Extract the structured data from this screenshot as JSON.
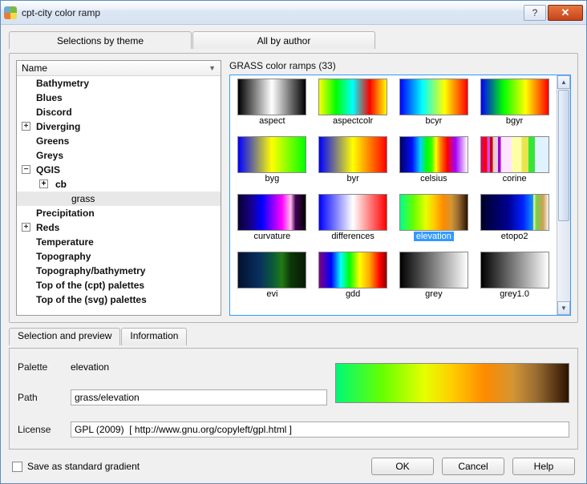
{
  "window": {
    "title": "cpt-city color ramp"
  },
  "tabs": {
    "selections": "Selections by theme",
    "author": "All by author"
  },
  "tree": {
    "header": "Name",
    "items": [
      {
        "label": "Bathymetry"
      },
      {
        "label": "Blues"
      },
      {
        "label": "Discord"
      },
      {
        "label": "Diverging",
        "expandable": true
      },
      {
        "label": "Greens"
      },
      {
        "label": "Greys"
      },
      {
        "label": "QGIS",
        "expandable": true,
        "expanded": true,
        "children": [
          {
            "label": "cb",
            "expandable": true
          },
          {
            "label": "grass",
            "selected": true
          }
        ]
      },
      {
        "label": "Precipitation"
      },
      {
        "label": "Reds",
        "expandable": true
      },
      {
        "label": "Temperature"
      },
      {
        "label": "Topography"
      },
      {
        "label": "Topography/bathymetry"
      },
      {
        "label": "Top of the (cpt) palettes"
      },
      {
        "label": "Top of the (svg) palettes"
      }
    ]
  },
  "gallery": {
    "title": "GRASS color ramps (33)",
    "items": [
      {
        "name": "aspect",
        "cls": "g-aspect"
      },
      {
        "name": "aspectcolr",
        "cls": "g-aspectcolr"
      },
      {
        "name": "bcyr",
        "cls": "g-bcyr"
      },
      {
        "name": "bgyr",
        "cls": "g-bgyr"
      },
      {
        "name": "byg",
        "cls": "g-byg"
      },
      {
        "name": "byr",
        "cls": "g-byr"
      },
      {
        "name": "celsius",
        "cls": "g-celsius"
      },
      {
        "name": "corine",
        "cls": "g-corine"
      },
      {
        "name": "curvature",
        "cls": "g-curvature"
      },
      {
        "name": "differences",
        "cls": "g-differences"
      },
      {
        "name": "elevation",
        "cls": "g-elevation",
        "selected": true
      },
      {
        "name": "etopo2",
        "cls": "g-etopo2"
      },
      {
        "name": "evi",
        "cls": "g-evi"
      },
      {
        "name": "gdd",
        "cls": "g-gdd"
      },
      {
        "name": "grey",
        "cls": "g-grey"
      },
      {
        "name": "grey1.0",
        "cls": "g-grey1"
      }
    ]
  },
  "subtabs": {
    "selprev": "Selection and preview",
    "info": "Information"
  },
  "details": {
    "paletteLabel": "Palette",
    "paletteValue": "elevation",
    "pathLabel": "Path",
    "pathValue": "grass/elevation",
    "licenseLabel": "License",
    "licenseValue": "GPL (2009)  [ http://www.gnu.org/copyleft/gpl.html ]"
  },
  "bottom": {
    "saveas": "Save as standard gradient",
    "ok": "OK",
    "cancel": "Cancel",
    "help": "Help"
  }
}
